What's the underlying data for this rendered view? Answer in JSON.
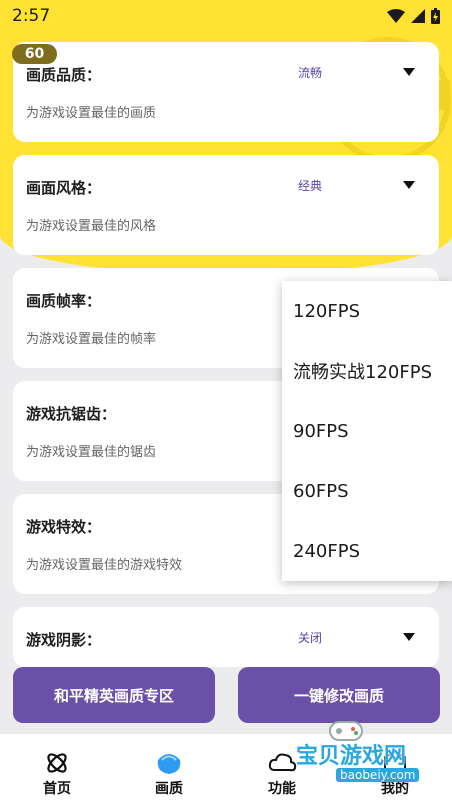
{
  "status": {
    "time": "2:57"
  },
  "badge": "60",
  "cards": [
    {
      "title": "画质品质：",
      "subtitle": "为游戏设置最佳的画质",
      "value": "流畅"
    },
    {
      "title": "画面风格：",
      "subtitle": "为游戏设置最佳的风格",
      "value": "经典"
    },
    {
      "title": "画质帧率：",
      "subtitle": "为游戏设置最佳的帧率",
      "value": ""
    },
    {
      "title": "游戏抗锯齿：",
      "subtitle": "为游戏设置最佳的锯齿",
      "value": ""
    },
    {
      "title": "游戏特效：",
      "subtitle": "为游戏设置最佳的游戏特效",
      "value": ""
    },
    {
      "title": "游戏阴影：",
      "subtitle": "",
      "value": "关闭"
    }
  ],
  "dropdown": {
    "options": [
      "120FPS",
      "流畅实战120FPS",
      "90FPS",
      "60FPS",
      "240FPS"
    ]
  },
  "actions": {
    "left": "和平精英画质专区",
    "right": "一键修改画质"
  },
  "nav": {
    "home": "首页",
    "quality": "画质",
    "function": "功能",
    "mine": "我的"
  },
  "watermark": {
    "text": "宝贝游戏网",
    "url": "baobeiy.com"
  },
  "colors": {
    "accent": "#6a50a7",
    "yellow": "#ffe233"
  }
}
